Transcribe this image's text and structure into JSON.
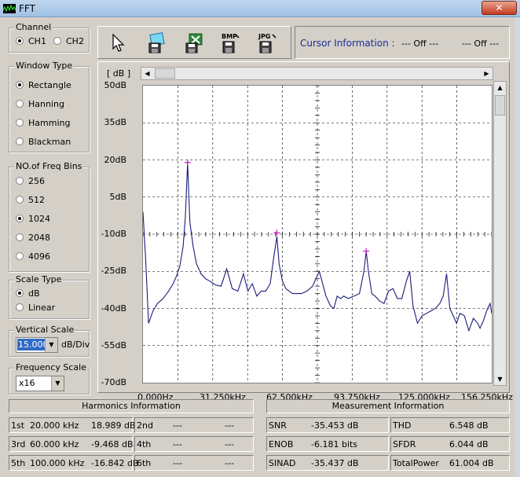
{
  "window": {
    "title": "FFT",
    "close_label": "✕"
  },
  "channel": {
    "label": "Channel",
    "options": [
      "CH1",
      "CH2"
    ],
    "selected": 0
  },
  "window_type": {
    "label": "Window Type",
    "options": [
      "Rectangle",
      "Hanning",
      "Hamming",
      "Blackman"
    ],
    "selected": 0
  },
  "freq_bins": {
    "label": "NO.of Freq Bins",
    "options": [
      "256",
      "512",
      "1024",
      "2048",
      "4096"
    ],
    "selected": 2
  },
  "scale_type": {
    "label": "Scale Type",
    "options": [
      "dB",
      "Linear"
    ],
    "selected": 0
  },
  "vertical_scale": {
    "label": "Vertical Scale",
    "value": "15.000",
    "unit": "dB/Div"
  },
  "frequency_scale": {
    "label": "Frequency Scale",
    "value": "x16"
  },
  "toolbar": {
    "icons": [
      "pointer-icon",
      "save-disk-icon",
      "excel-export-icon",
      "bmp-export-icon",
      "jpg-export-icon"
    ],
    "bmp_text": "BMP",
    "jpg_text": "JPG"
  },
  "cursor": {
    "label": "Cursor Information :",
    "value1": "--- Off ---",
    "value2": "--- Off ---"
  },
  "chart_data": {
    "type": "line",
    "ylabel": "[ dB ]",
    "y_ticks": [
      "50dB",
      "35dB",
      "20dB",
      "5dB",
      "-10dB",
      "-25dB",
      "-40dB",
      "-55dB",
      "-70dB"
    ],
    "x_ticks": [
      "0.000Hz",
      "31.250kHz",
      "62.500kHz",
      "93.750kHz",
      "125.000kHz",
      "156.250kHz"
    ],
    "xlim": [
      0,
      156.25
    ],
    "ylim": [
      -70,
      50
    ],
    "x_unit": "kHz",
    "series_color": "#1b1b7a",
    "grid": true,
    "series": [
      {
        "x": [
          0,
          1.2,
          2.5,
          4.5,
          6.5,
          9,
          11.5,
          13.5,
          15,
          16.5,
          18,
          19,
          20,
          21,
          22.5,
          24,
          26,
          28,
          30,
          32.5,
          35,
          37.5,
          40,
          42.5,
          44,
          45,
          47,
          49,
          51,
          53,
          55,
          57,
          58.5,
          60,
          61,
          62.5,
          64,
          65.5,
          67,
          69,
          71,
          73.5,
          76,
          79,
          82,
          84,
          85.5,
          87,
          88.5,
          90,
          92,
          94.5,
          97,
          99,
          100,
          101,
          102.5,
          104,
          106,
          108,
          110,
          112,
          114,
          116,
          118,
          119.5,
          121,
          123,
          125,
          127,
          129,
          131,
          133,
          134.5,
          136,
          137.5,
          139,
          140.5,
          142,
          144,
          146,
          148,
          150,
          151,
          152.5,
          154,
          155.5,
          156.25
        ],
        "y": [
          -1,
          -20,
          -46,
          -41,
          -38,
          -36,
          -33,
          -30,
          -27,
          -23,
          -15,
          -3,
          19,
          -5,
          -15,
          -22,
          -26,
          -28,
          -29,
          -30.5,
          -31,
          -24,
          -32,
          -33,
          -29,
          -26,
          -33,
          -30,
          -35,
          -33,
          -33,
          -30,
          -20,
          -11,
          -22,
          -29,
          -32,
          -33,
          -34,
          -34,
          -34,
          -33,
          -31,
          -25,
          -35,
          -39,
          -40,
          -35,
          -36,
          -35,
          -36,
          -35,
          -34,
          -25,
          -16.8,
          -25,
          -34,
          -35,
          -37,
          -38,
          -33,
          -32,
          -36,
          -36,
          -29,
          -25,
          -39,
          -46,
          -43,
          -42,
          -41,
          -40,
          -38,
          -35,
          -26,
          -40,
          -43,
          -46,
          -42,
          -43,
          -49,
          -44,
          -46,
          -48,
          -45,
          -41,
          -38,
          -42
        ]
      }
    ],
    "harmonic_markers": [
      {
        "x": 20,
        "y": 18.989
      },
      {
        "x": 60,
        "y": -9.468
      },
      {
        "x": 100,
        "y": -16.842
      }
    ]
  },
  "harmonics": {
    "title": "Harmonics Information",
    "rows": [
      [
        {
          "ord": "1st",
          "freq": "20.000 kHz",
          "db": "18.989 dB"
        },
        {
          "ord": "2nd",
          "freq": "---",
          "db": "---"
        }
      ],
      [
        {
          "ord": "3rd",
          "freq": "60.000 kHz",
          "db": "-9.468 dB"
        },
        {
          "ord": "4th",
          "freq": "---",
          "db": "---"
        }
      ],
      [
        {
          "ord": "5th",
          "freq": "100.000 kHz",
          "db": "-16.842 dB"
        },
        {
          "ord": "6th",
          "freq": "---",
          "db": "---"
        }
      ]
    ]
  },
  "measurement": {
    "title": "Measurement Information",
    "rows": [
      [
        {
          "name": "SNR",
          "value": "-35.453 dB"
        },
        {
          "name": "THD",
          "value": "6.548 dB"
        }
      ],
      [
        {
          "name": "ENOB",
          "value": "-6.181 bits"
        },
        {
          "name": "SFDR",
          "value": "6.044 dB"
        }
      ],
      [
        {
          "name": "SINAD",
          "value": "-35.437 dB"
        },
        {
          "name": "TotalPower",
          "value": "61.004 dB"
        }
      ]
    ]
  }
}
